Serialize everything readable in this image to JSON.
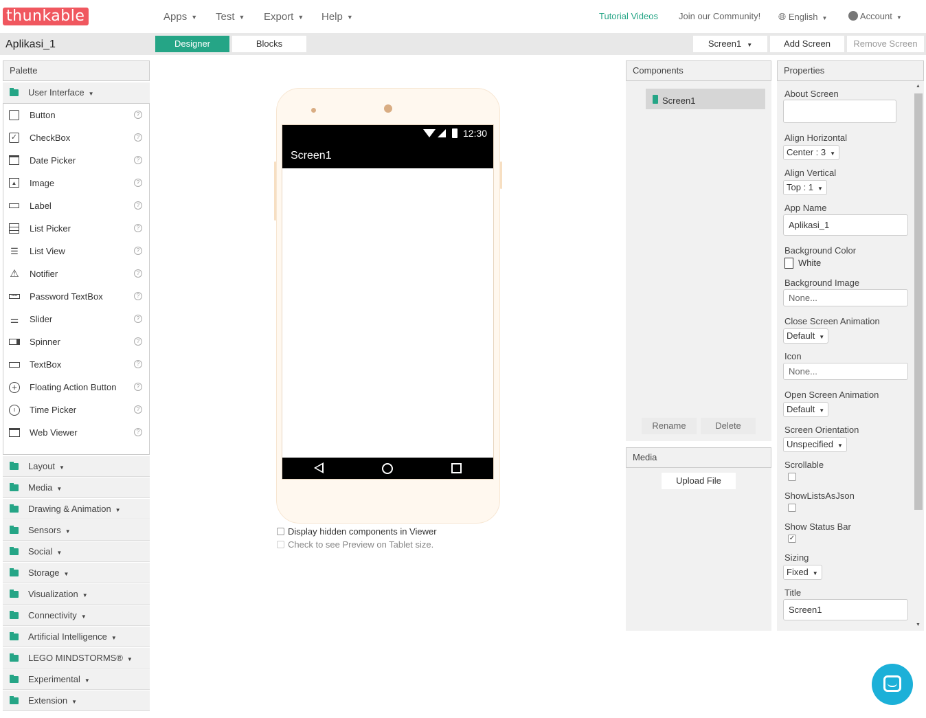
{
  "topbar": {
    "logo": "thunkable",
    "menus": [
      "Apps",
      "Test",
      "Export",
      "Help"
    ],
    "tutorial": "Tutorial Videos",
    "community": "Join our Community!",
    "language": "English",
    "account": "Account"
  },
  "project": {
    "name": "Aplikasi_1",
    "designer": "Designer",
    "blocks": "Blocks",
    "screen_select": "Screen1",
    "add_screen": "Add Screen",
    "remove_screen": "Remove Screen"
  },
  "palette": {
    "title": "Palette",
    "open_category": "User Interface",
    "items": [
      "Button",
      "CheckBox",
      "Date Picker",
      "Image",
      "Label",
      "List Picker",
      "List View",
      "Notifier",
      "Password TextBox",
      "Slider",
      "Spinner",
      "TextBox",
      "Floating Action Button",
      "Time Picker",
      "Web Viewer"
    ],
    "categories": [
      "Layout",
      "Media",
      "Drawing & Animation",
      "Sensors",
      "Social",
      "Storage",
      "Visualization",
      "Connectivity",
      "Artificial Intelligence",
      "LEGO MINDSTORMS®",
      "Experimental",
      "Extension"
    ]
  },
  "viewer": {
    "time": "12:30",
    "screen_title": "Screen1",
    "hidden_components": "Display hidden components in Viewer",
    "tablet_preview": "Check to see Preview on Tablet size."
  },
  "components": {
    "title": "Components",
    "tree_item": "Screen1",
    "rename": "Rename",
    "delete": "Delete"
  },
  "media": {
    "title": "Media",
    "upload": "Upload File"
  },
  "properties": {
    "title": "Properties",
    "about_screen": "About Screen",
    "align_horizontal": "Align Horizontal",
    "align_horizontal_val": "Center : 3",
    "align_vertical": "Align Vertical",
    "align_vertical_val": "Top : 1",
    "app_name": "App Name",
    "app_name_val": "Aplikasi_1",
    "bg_color": "Background Color",
    "bg_color_val": "White",
    "bg_image": "Background Image",
    "bg_image_val": "None...",
    "close_anim": "Close Screen Animation",
    "close_anim_val": "Default",
    "icon": "Icon",
    "icon_val": "None...",
    "open_anim": "Open Screen Animation",
    "open_anim_val": "Default",
    "orientation": "Screen Orientation",
    "orientation_val": "Unspecified",
    "scrollable": "Scrollable",
    "show_lists": "ShowListsAsJson",
    "status_bar": "Show Status Bar",
    "sizing": "Sizing",
    "sizing_val": "Fixed",
    "title_label": "Title",
    "title_val": "Screen1"
  },
  "colors": {
    "accent": "#25a586",
    "logo": "#f0575f",
    "chat": "#1cb0d8"
  }
}
